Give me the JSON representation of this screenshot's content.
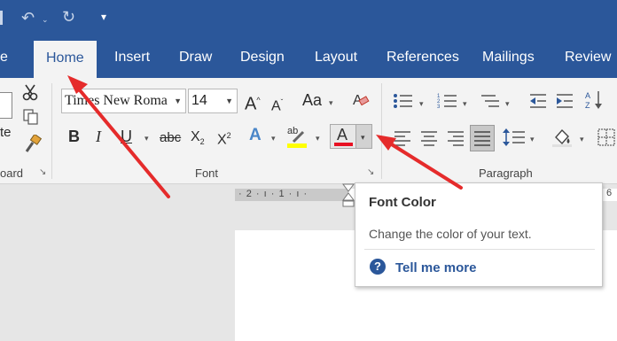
{
  "qat": {
    "undo_icon": "undo-icon",
    "redo_icon": "redo-icon",
    "customize_icon": "customize-qat-icon"
  },
  "tabs": [
    {
      "label": "e"
    },
    {
      "label": "Home"
    },
    {
      "label": "Insert"
    },
    {
      "label": "Draw"
    },
    {
      "label": "Design"
    },
    {
      "label": "Layout"
    },
    {
      "label": "References"
    },
    {
      "label": "Mailings"
    },
    {
      "label": "Review"
    }
  ],
  "clipboard": {
    "paste_fragment": "te",
    "group_label": "oard"
  },
  "font": {
    "name_value": "Times New Roma",
    "size_value": "14",
    "grow_label": "A",
    "shrink_label": "A",
    "case_label": "Aa",
    "bold_label": "B",
    "italic_label": "I",
    "underline_label": "U",
    "strike_label": "abc",
    "subscript_label": "X",
    "subscript_sub": "2",
    "superscript_label": "X",
    "superscript_sup": "2",
    "effects_label": "A",
    "highlight_label": "ab",
    "color_label": "A",
    "group_label": "Font"
  },
  "paragraph": {
    "group_label": "Paragraph"
  },
  "ruler": {
    "marks": "· 2 · ı · 1 · ı ·",
    "right_mark": "6"
  },
  "tooltip": {
    "title": "Font Color",
    "description": "Change the color of your text.",
    "link": "Tell me more",
    "help_glyph": "?"
  },
  "colors": {
    "ribbon_blue": "#2b579a",
    "font_color_underline": "#e81123",
    "highlight_yellow": "#ffff00",
    "arrow_red": "#e52b2b"
  }
}
